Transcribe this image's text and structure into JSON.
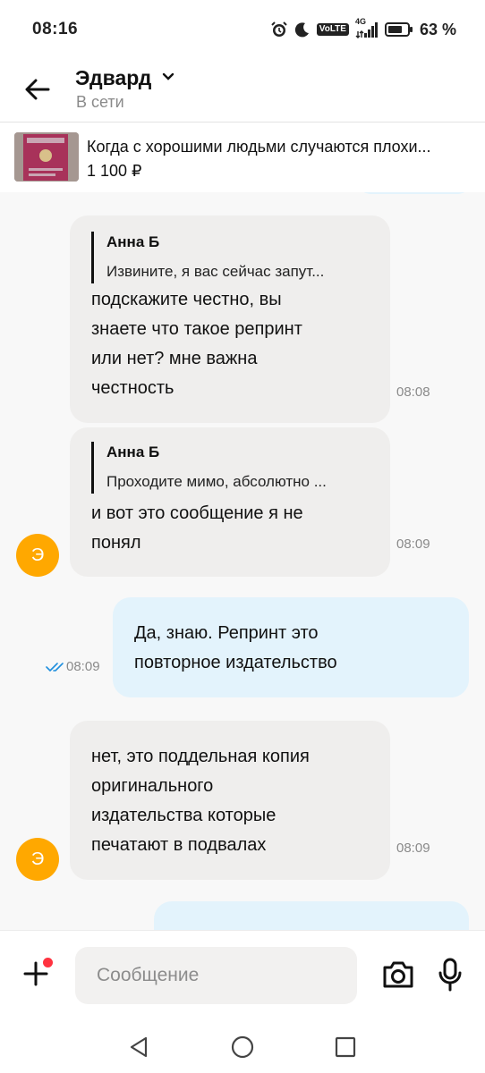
{
  "status_bar": {
    "time": "08:16",
    "network": "4G",
    "volte": "VoLTE",
    "battery": "63 %",
    "icons": [
      "alarm-icon",
      "moon-icon",
      "volte-icon",
      "signal-icon",
      "battery-icon"
    ]
  },
  "header": {
    "name": "Эдвард",
    "status": "В сети",
    "icons": [
      "back-arrow-icon",
      "chevron-down-icon"
    ]
  },
  "product": {
    "title": "Когда с хорошими людьми случаются плохи...",
    "price": "1 100 ₽"
  },
  "messages": [
    {
      "direction": "incoming",
      "reply": {
        "author": "Анна Б",
        "text": "Извините, я вас сейчас запут..."
      },
      "text": "подскажите честно, вы знаете что такое репринт или нет? мне важна честность",
      "lines": [
        "подскажите честно, вы",
        "знаете что такое репринт",
        "или нет? мне важна",
        "честность"
      ],
      "time": "08:08"
    },
    {
      "direction": "incoming",
      "reply": {
        "author": "Анна Б",
        "text": "Проходите мимо, абсолютно ..."
      },
      "text": "и вот это сообщение я не понял",
      "lines": [
        "и вот это сообщение я не",
        "понял"
      ],
      "time": "08:09",
      "avatar": "Э"
    },
    {
      "direction": "outgoing",
      "text": "Да, знаю. Репринт это повторное издательство",
      "lines": [
        "Да, знаю. Репринт это",
        "повторное издательство"
      ],
      "time": "08:09",
      "read": true
    },
    {
      "direction": "incoming",
      "text": "нет, это поддельная копия оригинального издательства которые печатают в подвалах",
      "lines": [
        "нет, это поддельная копия",
        "оригинального",
        "издательства которые",
        "печатают в подвалах"
      ],
      "time": "08:09",
      "avatar": "Э"
    }
  ],
  "input": {
    "placeholder": "Сообщение",
    "icons": [
      "plus-icon",
      "camera-icon",
      "microphone-icon"
    ]
  },
  "navbar": {
    "icons": [
      "back-triangle-icon",
      "home-circle-icon",
      "recents-square-icon"
    ]
  },
  "colors": {
    "incoming_bubble": "#efeeed",
    "outgoing_bubble": "#e3f3fc",
    "avatar": "#ffa800",
    "read_check": "#1f8fde",
    "notification_dot": "#ff3340"
  }
}
